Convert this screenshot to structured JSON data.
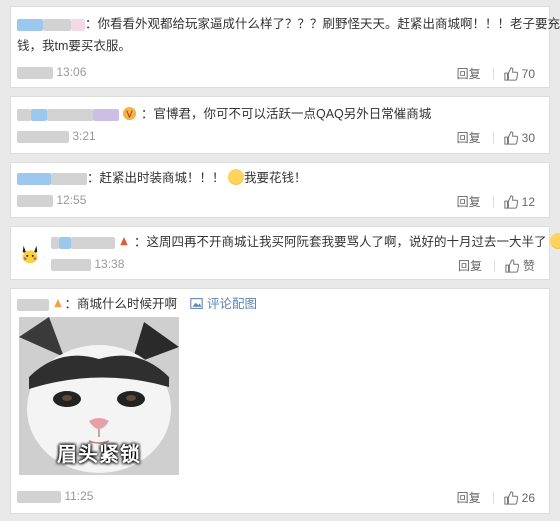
{
  "comments": [
    {
      "text_line1": "：你看看外观都给玩家逼成什么样了？？？刷野怪天天。赶紧出商城啊！！！老子要充",
      "text_line2": "钱，我tm要买衣服。",
      "time": "13:06",
      "reply": "回复",
      "likes": "70"
    },
    {
      "text": "：官博君，你可不可以活跃一点QAQ另外日常催商城",
      "time": "3:21",
      "reply": "回复",
      "likes": "30"
    },
    {
      "text": "：赶紧出时装商城！！！",
      "text_after_emoji": "我要花钱！",
      "time": "12:55",
      "reply": "回复",
      "likes": "12"
    },
    {
      "text": "：这周四再不开商城让我买阿阮套我要骂人了啊，说好的十月过去一大半了",
      "time": "13:38",
      "reply": "回复",
      "likes": "赞"
    },
    {
      "text": "：商城什么时候开啊",
      "pic_link": "评论配图",
      "image_caption": "眉头紧锁",
      "time": "11:25",
      "reply": "回复",
      "likes": "26"
    }
  ],
  "colors": {
    "link": "#5d84b8",
    "muted": "#999999",
    "border": "#dcdcdc"
  },
  "icons": [
    "thumbs-up-icon",
    "picture-icon",
    "crying-emoji",
    "laughing-emoji",
    "vip-badge-icon",
    "pikachu-avatar"
  ]
}
